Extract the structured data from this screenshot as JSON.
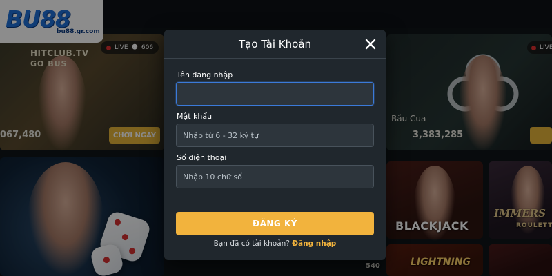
{
  "logo": {
    "brand": "BU88",
    "domain": "bu88.gr.com"
  },
  "background": {
    "tile1": {
      "title": "HITCLUB.TV",
      "subtitle": "GO BUS",
      "amount": "067,480",
      "play_button": "CHƠI NGAY",
      "live_label": "LIVE",
      "viewers": "606"
    },
    "tile2": {
      "game_name": "Bầu Cua",
      "amount": "3,383,285",
      "live_label": "LIVE"
    },
    "blackjack": "BLACKJACK",
    "immersive": "IMMERS",
    "roulette": "ROULETTE",
    "lightning": "LIGHTNING",
    "side_number": "540"
  },
  "modal": {
    "title": "Tạo Tài Khoản",
    "username": {
      "label": "Tên đăng nhập",
      "value": "",
      "placeholder": ""
    },
    "password": {
      "label": "Mật khẩu",
      "placeholder": "Nhập từ 6 - 32 ký tự"
    },
    "phone": {
      "label": "Số điện thoại",
      "placeholder": "Nhập 10 chữ số"
    },
    "submit_label": "ĐĂNG KÝ",
    "login_prompt": "Bạn đã có tài khoản?",
    "login_link": "Đăng nhập"
  },
  "colors": {
    "accent": "#f2b33d",
    "modal_bg": "#20272d",
    "field_bg": "#2d353c",
    "focus_border": "#3b7ad9",
    "logo_blue": "#1e6fd8"
  }
}
